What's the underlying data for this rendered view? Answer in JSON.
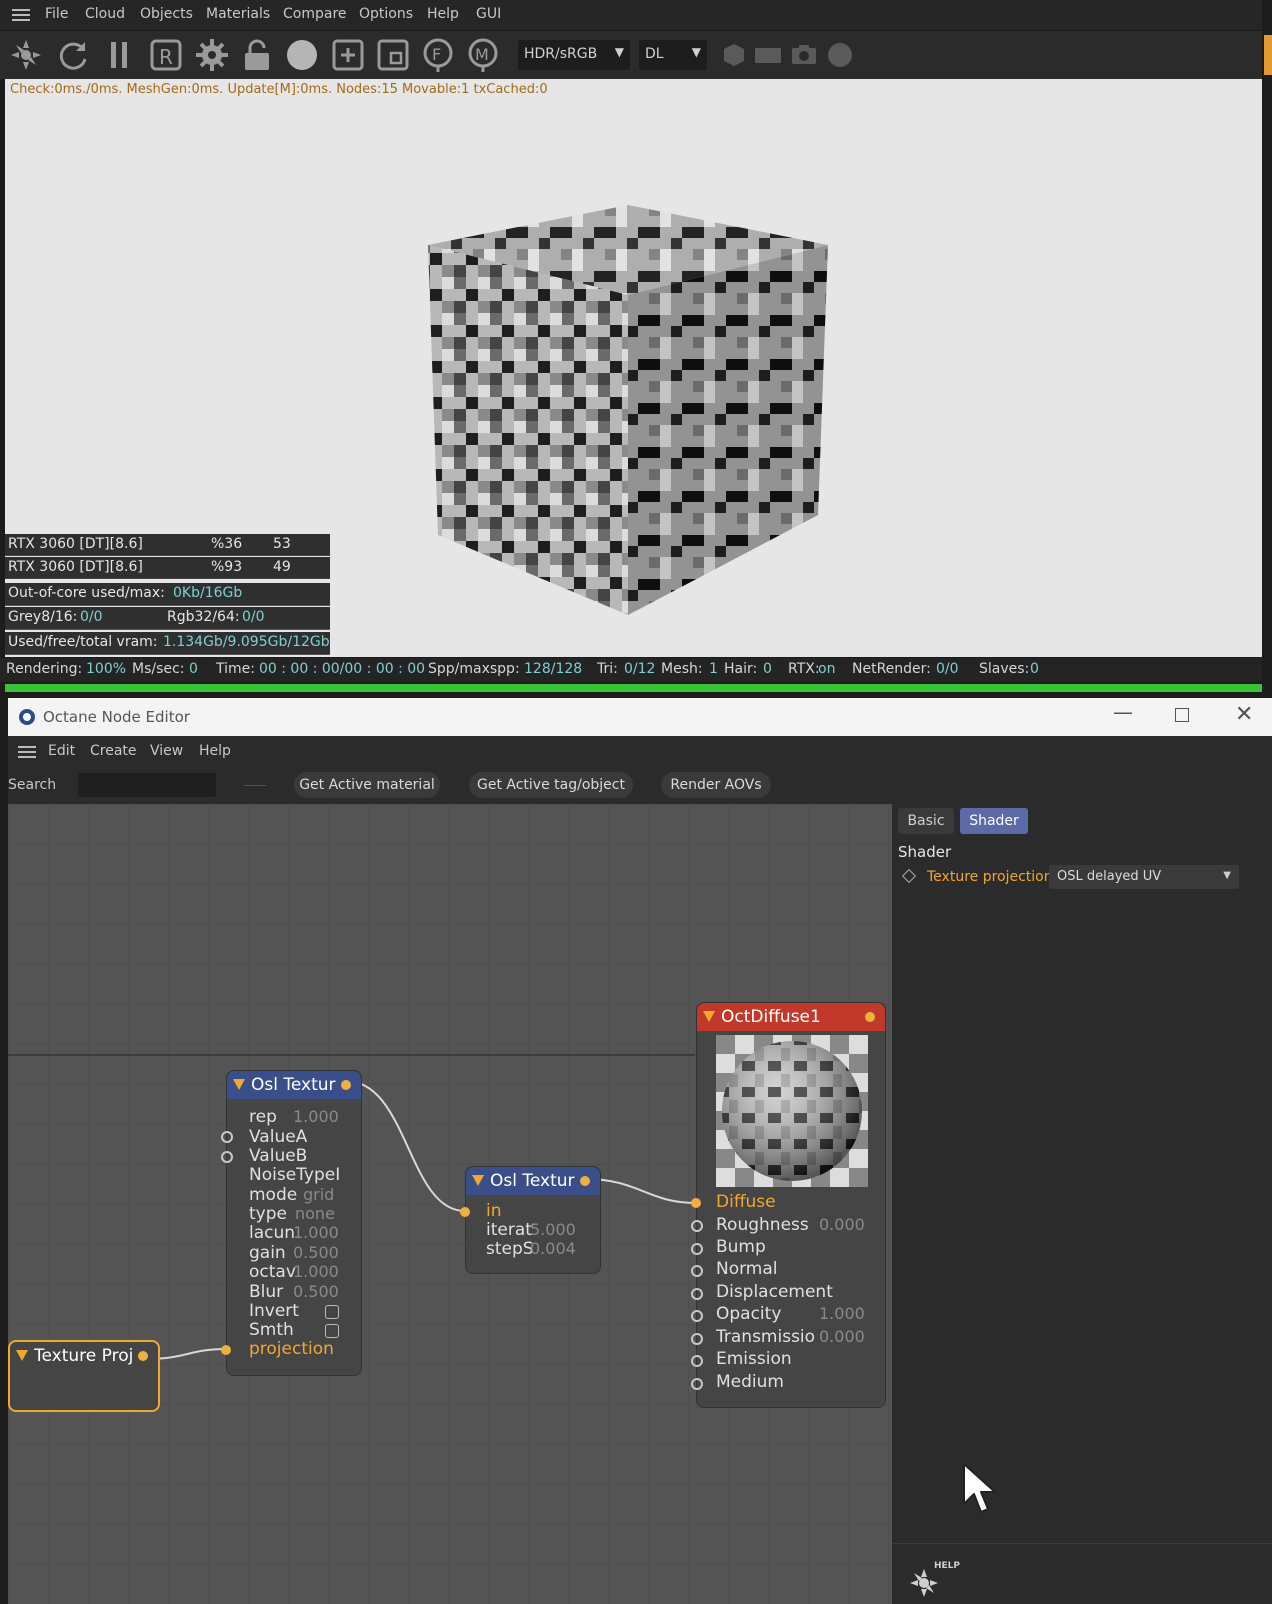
{
  "menu": {
    "items": [
      "File",
      "Cloud",
      "Objects",
      "Materials",
      "Compare",
      "Options",
      "Help",
      "GUI"
    ]
  },
  "toolbar": {
    "icons": [
      "octane-logo-icon",
      "refresh-icon",
      "pause-icon",
      "r-icon",
      "gear-icon",
      "lock-icon",
      "sphere-icon",
      "add-region-icon",
      "region-icon",
      "f-icon",
      "m-icon",
      "hexagon-icon",
      "rectangle-icon",
      "camera-icon",
      "circle-icon"
    ],
    "color_mode": "HDR/sRGB",
    "kernel": "DL"
  },
  "viewport": {
    "stats_line": "Check:0ms./0ms. MeshGen:0ms. Update[M]:0ms. Nodes:15 Movable:1 txCached:0",
    "gpus": [
      {
        "name": "RTX 3060 [DT][8.6]",
        "usage": "%36",
        "temp": "53"
      },
      {
        "name": "RTX 3060 [DT][8.6]",
        "usage": "%93",
        "temp": "49"
      }
    ],
    "out_of_core": {
      "label": "Out-of-core used/max:",
      "value": "0Kb/16Gb"
    },
    "grey": {
      "label": "Grey8/16:",
      "value": "0/0"
    },
    "rgb": {
      "label": "Rgb32/64:",
      "value": "0/0"
    },
    "vram": {
      "label": "Used/free/total vram:",
      "value": "1.134Gb/9.095Gb/12Gb"
    }
  },
  "status": {
    "rendering_label": "Rendering:",
    "rendering_value": "100%",
    "mssec_label": "Ms/sec:",
    "mssec_value": "0",
    "time_label": "Time:",
    "time_value": "00 : 00 : 00/00 : 00 : 00",
    "spp_label": "Spp/maxspp:",
    "spp_value": "128/128",
    "tri_label": "Tri:",
    "tri_value": "0/12",
    "mesh_label": "Mesh:",
    "mesh_value": "1",
    "hair_label": "Hair:",
    "hair_value": "0",
    "rtx_label": "RTX:",
    "rtx_value": "on",
    "net_label": "NetRender:",
    "net_value": "0/0",
    "slaves_label": "Slaves:",
    "slaves_value": "0",
    "progress": 1.0
  },
  "node_editor": {
    "title": "Octane Node Editor",
    "menu": [
      "Edit",
      "Create",
      "View",
      "Help"
    ],
    "search_label": "Search",
    "buttons": [
      "Get Active material",
      "Get Active tag/object",
      "Render AOVs"
    ],
    "tabs": [
      "Basic",
      "Shader"
    ],
    "section": "Shader",
    "param_label": "Texture projection",
    "param_value": "OSL delayed UV",
    "help_label": "HELP"
  },
  "nodes": {
    "osl1": {
      "title": "Osl Textur",
      "rows": [
        {
          "label": "rep",
          "value": "1.000"
        },
        {
          "label": "ValueA",
          "value": ""
        },
        {
          "label": "ValueB",
          "value": ""
        },
        {
          "label": "NoiseTypeI",
          "value": ""
        },
        {
          "label": "mode",
          "value": "grid"
        },
        {
          "label": "type",
          "value": "none"
        },
        {
          "label": "lacun",
          "value": "1.000"
        },
        {
          "label": "gain",
          "value": "0.500"
        },
        {
          "label": "octav",
          "value": "1.000"
        },
        {
          "label": "Blur",
          "value": "0.500"
        },
        {
          "label": "Invert",
          "value": ""
        },
        {
          "label": "Smth",
          "value": ""
        },
        {
          "label": "projection",
          "value": ""
        }
      ]
    },
    "osl2": {
      "title": "Osl Textur",
      "rows": [
        {
          "label": "in",
          "value": ""
        },
        {
          "label": "iterat",
          "value": "5.000"
        },
        {
          "label": "stepS",
          "value": "0.004"
        }
      ]
    },
    "diffuse": {
      "title": "OctDiffuse1",
      "rows": [
        {
          "label": "Diffuse",
          "value": ""
        },
        {
          "label": "Roughness",
          "value": "0.000"
        },
        {
          "label": "Bump",
          "value": ""
        },
        {
          "label": "Normal",
          "value": ""
        },
        {
          "label": "Displacement",
          "value": ""
        },
        {
          "label": "Opacity",
          "value": "1.000"
        },
        {
          "label": "Transmissio",
          "value": "0.000"
        },
        {
          "label": "Emission",
          "value": ""
        },
        {
          "label": "Medium",
          "value": ""
        }
      ]
    },
    "texproj": {
      "title": "Texture Proj"
    }
  },
  "colors": {
    "accent": "#f0a830",
    "status_value": "#7ed0d0",
    "diffuse_header": "#c0392b",
    "osl_header": "#3a4f8a",
    "progress": "#3bc23b"
  }
}
